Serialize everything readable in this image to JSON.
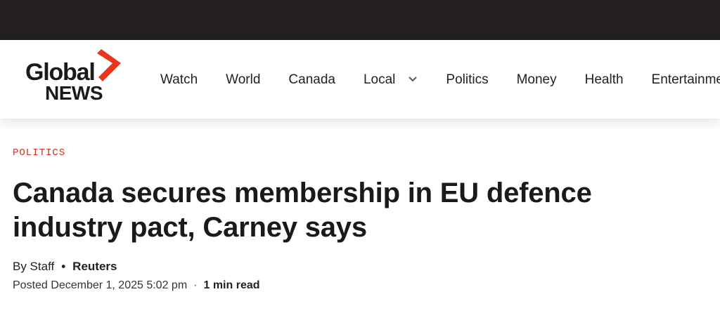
{
  "header": {
    "logo": {
      "line1": "Global",
      "line2": "NEWS",
      "accent_color": "#e8361e"
    },
    "nav": [
      {
        "label": "Watch"
      },
      {
        "label": "World"
      },
      {
        "label": "Canada"
      },
      {
        "label": "Local",
        "icon": "chevron-down-icon"
      },
      {
        "label": "Politics"
      },
      {
        "label": "Money"
      },
      {
        "label": "Health"
      },
      {
        "label": "Entertainment"
      }
    ]
  },
  "article": {
    "category": "POLITICS",
    "category_color": "#d0301f",
    "headline": "Canada secures membership in EU defence industry pact, Carney says",
    "byline": {
      "author": "By Staff",
      "separator": "•",
      "source": "Reuters"
    },
    "meta": {
      "posted": "Posted December 1, 2025 5:02 pm",
      "separator": "·",
      "read_time": "1 min read"
    }
  }
}
